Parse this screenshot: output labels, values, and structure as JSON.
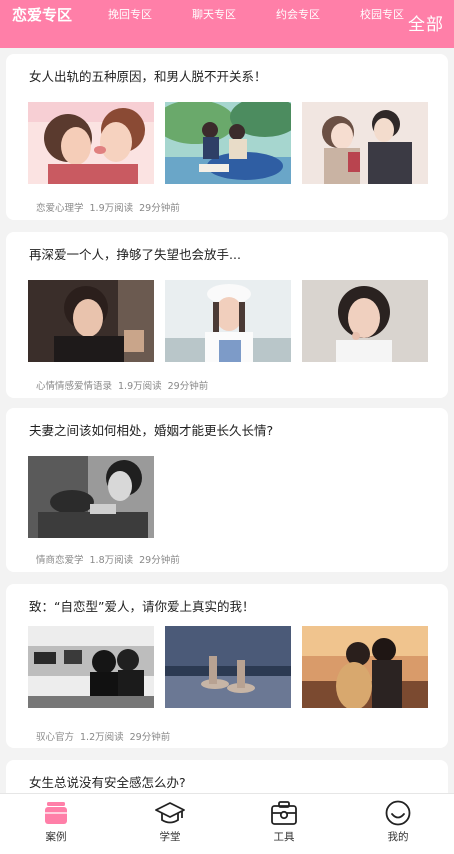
{
  "top_tabs": {
    "active": "恋爱专区",
    "items": [
      "挽回专区",
      "聊天专区",
      "约会专区",
      "校园专区"
    ],
    "all_label": "全部"
  },
  "articles": [
    {
      "title": "女人出轨的五种原因，和男人脱不开关系！",
      "source": "恋爱心理学",
      "reads": "1.9万阅读",
      "time": "29分钟前",
      "images": [
        "couple-kiss-illustration",
        "couple-picnic-illustration",
        "couple-sketch-illustration"
      ]
    },
    {
      "title": "再深爱一个人，挣够了失望也会放手...",
      "source": "心情情感爱情语录",
      "reads": "1.9万阅读",
      "time": "29分钟前",
      "images": [
        "woman-portrait-dark",
        "woman-portrait-hat",
        "woman-portrait-light"
      ]
    },
    {
      "title": "夫妻之间该如何相处，婚姻才能更长久长情?",
      "source": "情商恋爱学",
      "reads": "1.8万阅读",
      "time": "29分钟前",
      "images": [
        "couple-bw-photo"
      ]
    },
    {
      "title": "致：“自恋型”爱人，请你爱上真实的我！",
      "source": "驭心官方",
      "reads": "1.2万阅读",
      "time": "29分钟前",
      "images": [
        "couple-bw-street",
        "feet-floor-photo",
        "couple-sunset-photo"
      ]
    },
    {
      "title": "女生总说没有安全感怎么办?",
      "source": "",
      "reads": "",
      "time": "",
      "images": []
    }
  ],
  "bottom_nav": [
    {
      "label": "案例",
      "icon": "case-icon",
      "active": true
    },
    {
      "label": "学堂",
      "icon": "graduation-cap-icon",
      "active": false
    },
    {
      "label": "工具",
      "icon": "toolbox-icon",
      "active": false
    },
    {
      "label": "我的",
      "icon": "smiley-icon",
      "active": false
    }
  ],
  "colors": {
    "accent": "#ff7fa8",
    "background": "#f3f3f3"
  }
}
